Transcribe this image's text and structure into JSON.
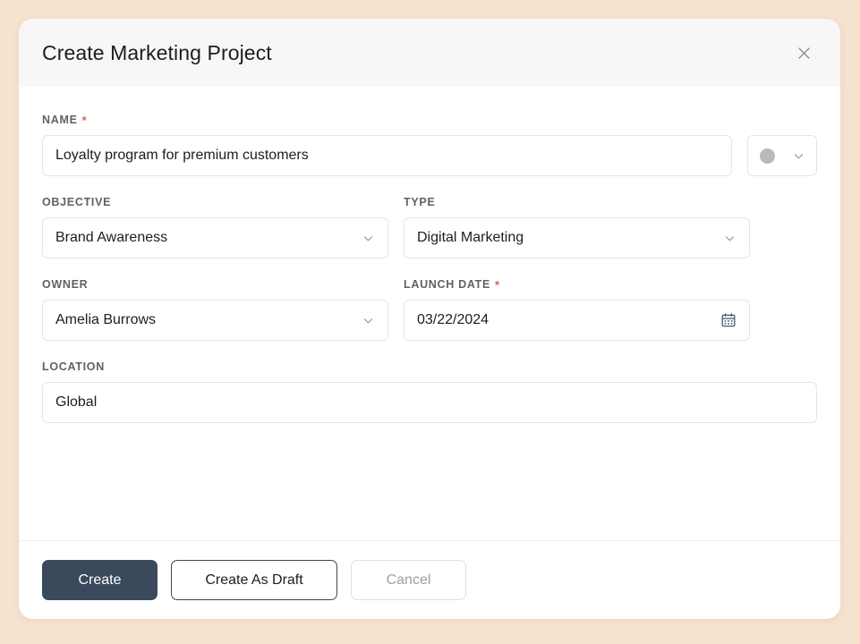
{
  "dialog": {
    "title": "Create Marketing Project",
    "close_icon": "close-icon"
  },
  "fields": {
    "name": {
      "label": "NAME",
      "required": "*",
      "value": "Loyalty program for premium customers",
      "color_swatch": "#b6b9bd",
      "swatch_chevron_icon": "chevron-down-icon"
    },
    "objective": {
      "label": "OBJECTIVE",
      "value": "Brand Awareness",
      "chevron_icon": "chevron-down-icon"
    },
    "type": {
      "label": "TYPE",
      "value": "Digital Marketing",
      "chevron_icon": "chevron-down-icon"
    },
    "owner": {
      "label": "OWNER",
      "value": "Amelia Burrows",
      "chevron_icon": "chevron-down-icon"
    },
    "launch_date": {
      "label": "LAUNCH DATE",
      "required": "*",
      "value": "03/22/2024",
      "calendar_icon": "calendar-icon"
    },
    "location": {
      "label": "LOCATION",
      "value": "Global"
    }
  },
  "footer": {
    "create_label": "Create",
    "draft_label": "Create As Draft",
    "cancel_label": "Cancel"
  },
  "colors": {
    "page_background": "#f7e2cf",
    "header_background": "#f7f7f7",
    "primary_button": "#3a4a5c",
    "required_asterisk": "#e35d52",
    "label_text": "#5d6268",
    "muted_text": "#9aa0a6"
  }
}
